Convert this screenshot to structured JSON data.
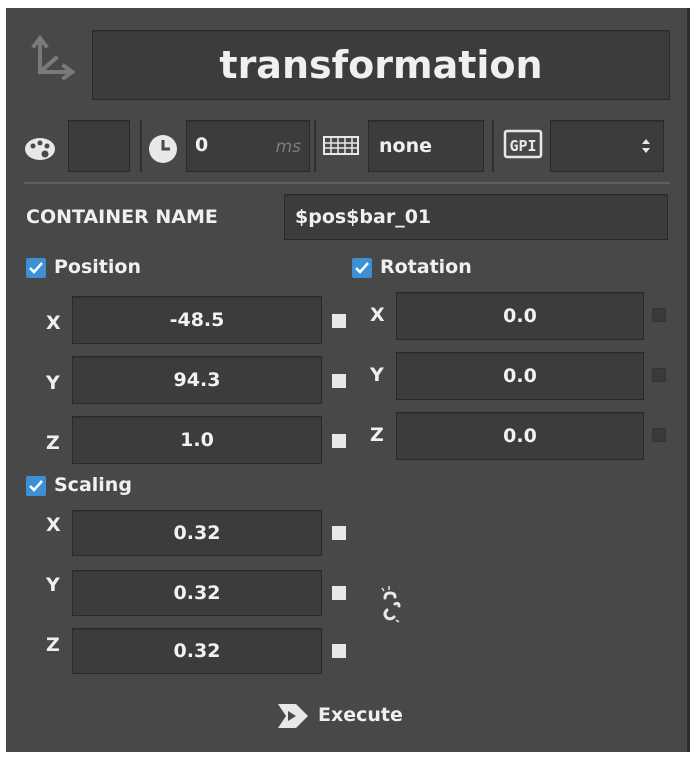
{
  "header": {
    "title": "transformation",
    "icon": "transform-axes-icon"
  },
  "toolbar": {
    "palette_icon": "palette-icon",
    "clock_icon": "clock-icon",
    "duration_value": "0",
    "duration_unit": "ms",
    "grid_icon": "grid-icon",
    "layout_value": "none",
    "gpi_icon": "gpi-icon",
    "gpi_select_value": "",
    "gpi_select_icon": "spinner-arrows-icon"
  },
  "container": {
    "label": "CONTAINER NAME",
    "value": "$pos$bar_01"
  },
  "position": {
    "label": "Position",
    "checked": true,
    "x": {
      "axis": "X",
      "value": "-48.5"
    },
    "y": {
      "axis": "Y",
      "value": "94.3"
    },
    "z": {
      "axis": "Z",
      "value": "1.0"
    }
  },
  "rotation": {
    "label": "Rotation",
    "checked": true,
    "x": {
      "axis": "X",
      "value": "0.0"
    },
    "y": {
      "axis": "Y",
      "value": "0.0"
    },
    "z": {
      "axis": "Z",
      "value": "0.0"
    }
  },
  "scaling": {
    "label": "Scaling",
    "checked": true,
    "x": {
      "axis": "X",
      "value": "0.32"
    },
    "y": {
      "axis": "Y",
      "value": "0.32"
    },
    "z": {
      "axis": "Z",
      "value": "0.32"
    },
    "link_icon": "broken-link-icon"
  },
  "footer": {
    "execute_label": "Execute",
    "execute_icon": "execute-icon"
  },
  "colors": {
    "panel_bg": "#484848",
    "field_bg": "#3c3c3c",
    "checkbox": "#3d8fd6",
    "text": "#f0f0f0"
  }
}
